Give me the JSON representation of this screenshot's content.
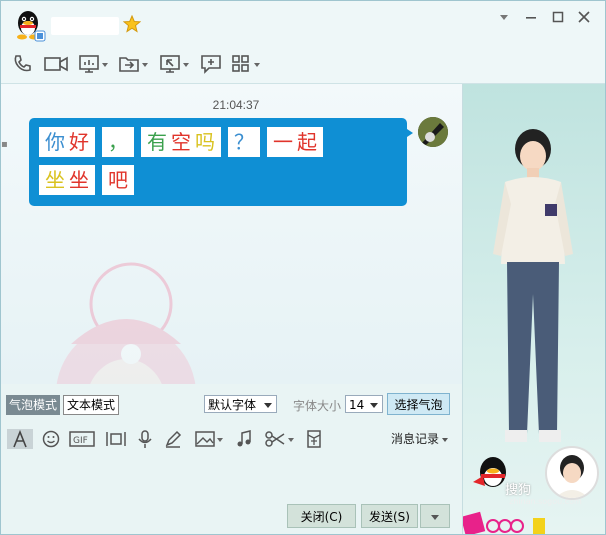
{
  "header": {
    "logo_icon": "qq-penguin-icon",
    "contact_name": "",
    "vip_icon": "star-icon"
  },
  "window_controls": [
    "dropdown-icon",
    "minimize-icon",
    "maximize-icon",
    "close-icon"
  ],
  "toolbar": {
    "items": [
      "phone-icon",
      "video-icon",
      "screen-share-icon",
      "file-transfer-icon",
      "remote-desktop-icon",
      "add-chat-icon",
      "apps-icon"
    ]
  },
  "chat": {
    "timestamp": "21:04:37",
    "message_line1": [
      {
        "text": "你好",
        "chars": [
          {
            "c": "你",
            "color": "#3a8ed0"
          },
          {
            "c": "好",
            "color": "#e0342b"
          }
        ]
      },
      {
        "text": "，",
        "chars": [
          {
            "c": "，",
            "color": "#3aa04c"
          }
        ]
      },
      {
        "text": "有空吗",
        "chars": [
          {
            "c": "有",
            "color": "#3aa04c"
          },
          {
            "c": "空",
            "color": "#e0342b"
          },
          {
            "c": "吗",
            "color": "#d9c21e"
          }
        ]
      },
      {
        "text": "？",
        "chars": [
          {
            "c": "？",
            "color": "#3a8ed0"
          }
        ]
      },
      {
        "text": "一起",
        "chars": [
          {
            "c": "一",
            "color": "#e0342b"
          },
          {
            "c": "起",
            "color": "#e0342b"
          }
        ]
      }
    ],
    "message_line2": [
      {
        "text": "坐坐",
        "chars": [
          {
            "c": "坐",
            "color": "#d9c21e"
          },
          {
            "c": "坐",
            "color": "#e0342b"
          }
        ]
      },
      {
        "text": "吧",
        "chars": [
          {
            "c": "吧",
            "color": "#e0342b"
          }
        ]
      }
    ]
  },
  "input_toolbar": {
    "bubble_mode": "气泡模式",
    "text_mode": "文本模式",
    "font_select": "默认字体",
    "font_size_label": "字体大小",
    "font_size_value": "14",
    "choose_bubble": "选择气泡",
    "history": "消息记录",
    "icons": [
      "font-icon",
      "emoji-icon",
      "gif-icon",
      "screenshot-icon",
      "voice-icon",
      "handwriting-icon",
      "image-icon",
      "music-icon",
      "scissors-icon",
      "red-packet-icon"
    ]
  },
  "buttons": {
    "close": "关闭(C)",
    "send": "发送(S)"
  },
  "watermark": {
    "text": "搜狗",
    "url": "zhinan.sogou.com"
  },
  "colors": {
    "bubble": "#0f8fd4",
    "accent": "#3a8ed0"
  }
}
